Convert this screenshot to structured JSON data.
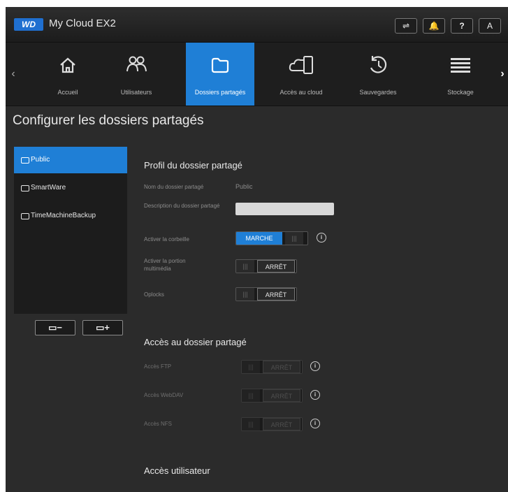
{
  "topbar": {
    "logo": "WD",
    "title": "My Cloud EX2",
    "buttons": {
      "usb": "⇌",
      "alerts": "🔔",
      "help": "?",
      "user": "A"
    }
  },
  "nav": {
    "items": [
      {
        "label": "Accueil",
        "icon": "home-icon"
      },
      {
        "label": "Utilisateurs",
        "icon": "users-icon"
      },
      {
        "label": "Dossiers partagés",
        "icon": "folder-icon"
      },
      {
        "label": "Accès au cloud",
        "icon": "cloud-device-icon"
      },
      {
        "label": "Sauvegardes",
        "icon": "history-icon"
      },
      {
        "label": "Stockage",
        "icon": "storage-icon"
      }
    ]
  },
  "page": {
    "title": "Configurer les dossiers partagés"
  },
  "shares": {
    "items": [
      {
        "label": "Public",
        "selected": true
      },
      {
        "label": "SmartWare",
        "selected": false
      },
      {
        "label": "TimeMachineBackup",
        "selected": false
      }
    ],
    "remove_label": "▭−",
    "add_label": "▭+"
  },
  "profile": {
    "heading": "Profil du dossier partagé",
    "name_label": "Nom du dossier partagé",
    "name_value": "Public",
    "description_label": "Description du dossier partagé",
    "description_value": "",
    "recycle_label": "Activer la corbeille",
    "recycle_state": "MARCHE",
    "media_label": "Activer la portion multimédia",
    "media_state": "ARRÊT",
    "oplocks_label": "Oplocks",
    "oplocks_state": "ARRÊT"
  },
  "access": {
    "heading": "Accès au dossier partagé",
    "ftp_label": "Accès FTP",
    "ftp_state": "ARRÊT",
    "webdav_label": "Accès WebDAV",
    "webdav_state": "ARRÊT",
    "nfs_label": "Accès NFS",
    "nfs_state": "ARRÊT"
  },
  "user_access": {
    "heading": "Accès utilisateur"
  },
  "toggle_grip": "|||",
  "colors": {
    "accent": "#1f7fd6",
    "background": "#2b2b2b"
  }
}
